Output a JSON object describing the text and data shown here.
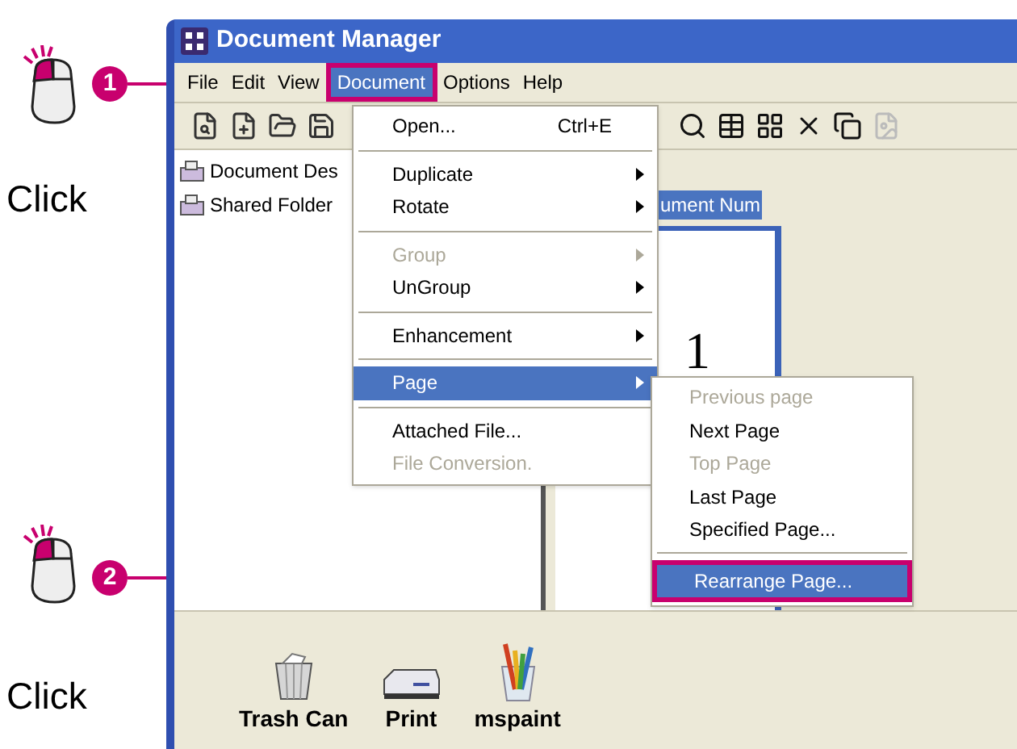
{
  "callouts": [
    {
      "number": "1",
      "label": "Click"
    },
    {
      "number": "2",
      "label": "Click"
    }
  ],
  "window": {
    "title": "Document Manager"
  },
  "menu_bar": [
    {
      "label": "File",
      "selected": false
    },
    {
      "label": "Edit",
      "selected": false
    },
    {
      "label": "View",
      "selected": false
    },
    {
      "label": "Document",
      "selected": true
    },
    {
      "label": "Options",
      "selected": false
    },
    {
      "label": "Help",
      "selected": false
    }
  ],
  "tree": [
    {
      "label": "Document Des"
    },
    {
      "label": "Shared Folder"
    }
  ],
  "document_view": {
    "column_header": "ument Num",
    "page_number": "1"
  },
  "document_menu": [
    {
      "kind": "item",
      "label": "Open...",
      "shortcut": "Ctrl+E",
      "submenu": false,
      "disabled": false,
      "selected": false
    },
    {
      "kind": "separator"
    },
    {
      "kind": "item",
      "label": "Duplicate",
      "submenu": true,
      "disabled": false,
      "selected": false
    },
    {
      "kind": "item",
      "label": "Rotate",
      "submenu": true,
      "disabled": false,
      "selected": false
    },
    {
      "kind": "separator"
    },
    {
      "kind": "item",
      "label": "Group",
      "submenu": true,
      "disabled": true,
      "selected": false
    },
    {
      "kind": "item",
      "label": "UnGroup",
      "submenu": true,
      "disabled": false,
      "selected": false
    },
    {
      "kind": "separator"
    },
    {
      "kind": "item",
      "label": "Enhancement",
      "submenu": true,
      "disabled": false,
      "selected": false
    },
    {
      "kind": "separator"
    },
    {
      "kind": "item",
      "label": "Page",
      "submenu": true,
      "disabled": false,
      "selected": true
    },
    {
      "kind": "separator"
    },
    {
      "kind": "item",
      "label": "Attached File...",
      "submenu": false,
      "disabled": false,
      "selected": false
    },
    {
      "kind": "item",
      "label": "File Conversion.",
      "submenu": false,
      "disabled": true,
      "selected": false
    }
  ],
  "page_submenu": [
    {
      "kind": "item",
      "label": "Previous page",
      "disabled": true,
      "selected": false
    },
    {
      "kind": "item",
      "label": "Next Page",
      "disabled": false,
      "selected": false
    },
    {
      "kind": "item",
      "label": "Top Page",
      "disabled": true,
      "selected": false
    },
    {
      "kind": "item",
      "label": "Last Page",
      "disabled": false,
      "selected": false
    },
    {
      "kind": "item",
      "label": "Specified Page...",
      "disabled": false,
      "selected": false
    },
    {
      "kind": "separator"
    },
    {
      "kind": "item",
      "label": "Rearrange Page...",
      "disabled": false,
      "selected": true
    }
  ],
  "tray": [
    {
      "label": "Trash Can",
      "kind": "trash"
    },
    {
      "label": "Print",
      "kind": "printer"
    },
    {
      "label": "mspaint",
      "kind": "paint"
    }
  ]
}
